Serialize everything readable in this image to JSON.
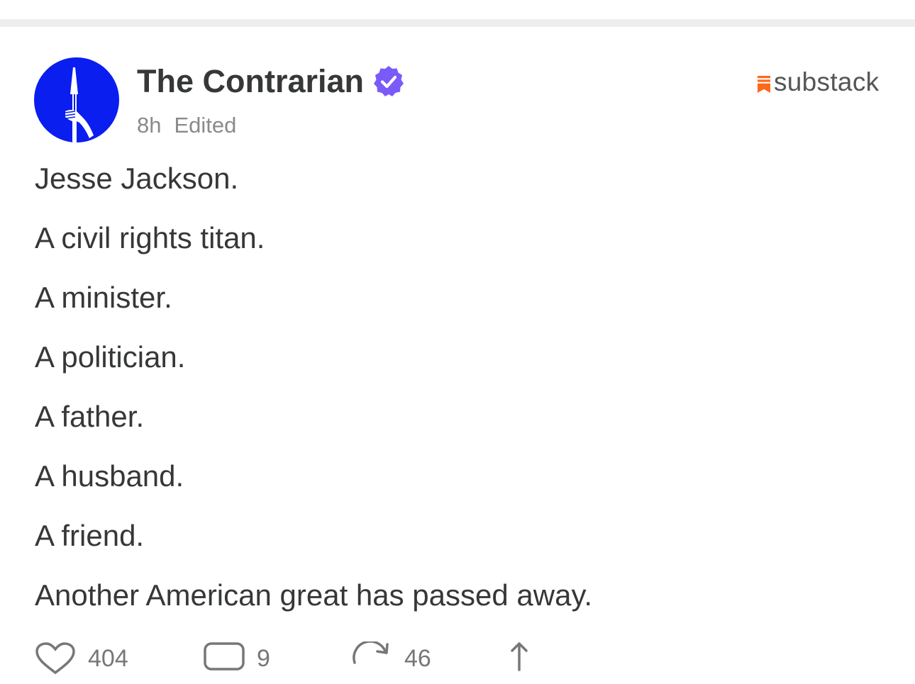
{
  "post": {
    "author": "The Contrarian",
    "verified_icon": "verified-badge-icon",
    "time": "8h",
    "status": "Edited",
    "brand": "substack",
    "brand_color": "#ff6719",
    "verified_color": "#7a5af8",
    "avatar_bg": "#0a1ef0",
    "lines": [
      "Jesse Jackson.",
      "A civil rights titan.",
      "A minister.",
      "A politician.",
      "A father.",
      "A husband.",
      "A friend.",
      "Another American great has passed away."
    ]
  },
  "actions": {
    "like_count": "404",
    "comment_count": "9",
    "restack_count": "46"
  }
}
